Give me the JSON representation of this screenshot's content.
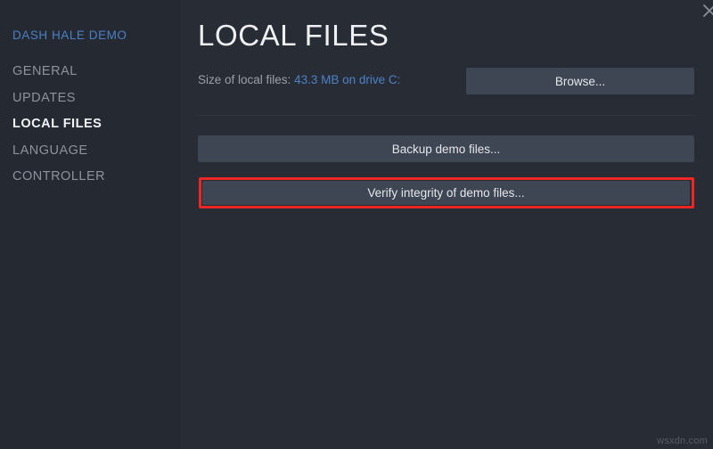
{
  "window": {
    "close_icon": "close-icon"
  },
  "sidebar": {
    "game_title": "DASH HALE DEMO",
    "items": [
      {
        "label": "GENERAL",
        "active": false
      },
      {
        "label": "UPDATES",
        "active": false
      },
      {
        "label": "LOCAL FILES",
        "active": true
      },
      {
        "label": "LANGUAGE",
        "active": false
      },
      {
        "label": "CONTROLLER",
        "active": false
      }
    ]
  },
  "main": {
    "page_title": "LOCAL FILES",
    "size_label": "Size of local files:",
    "size_value": "43.3 MB on drive C:",
    "browse_label": "Browse...",
    "backup_label": "Backup demo files...",
    "verify_label": "Verify integrity of demo files..."
  },
  "annotation": {
    "highlight_color": "#ee2626",
    "target": "verify-button"
  },
  "colors": {
    "accent_blue": "#4d82c8",
    "sidebar_bg": "#252932",
    "main_bg": "#282c35",
    "button_bg": "#3e4553",
    "active_text": "#f1f3f6",
    "muted_text": "#8d939d"
  },
  "watermark": {
    "text": "wsxdn.com"
  }
}
